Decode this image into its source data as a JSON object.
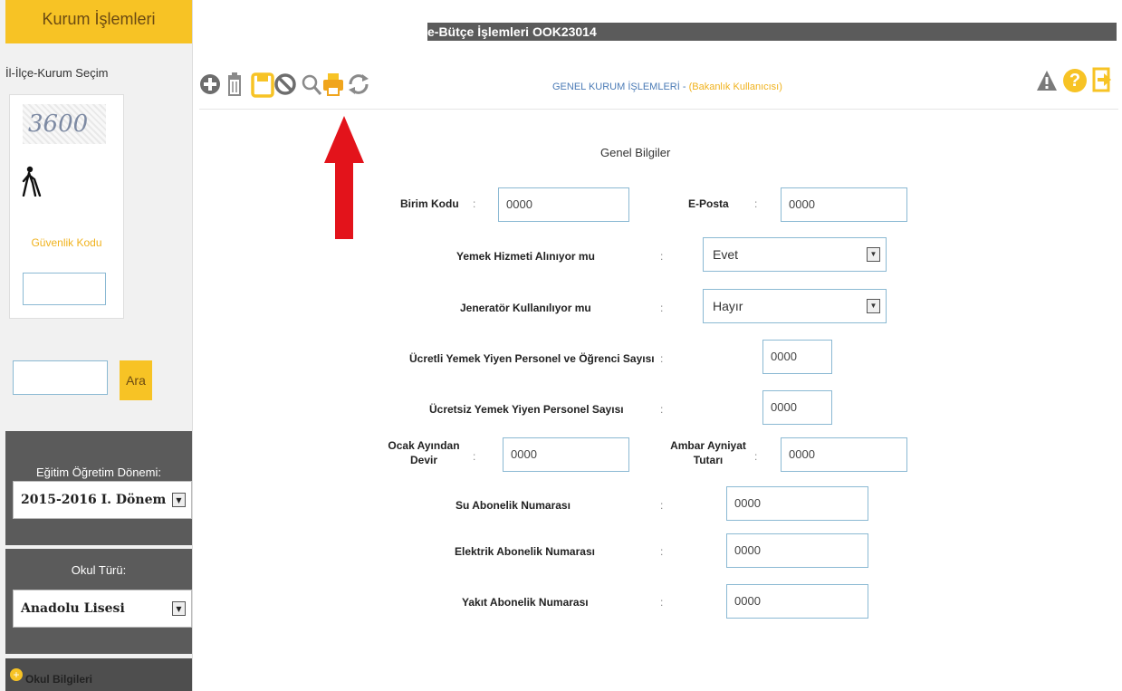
{
  "sidebar": {
    "header": "Kurum İşlemleri",
    "section_label": "İl-İlçe-Kurum Seçim",
    "captcha_text": "3600",
    "security_label": "Güvenlik Kodu",
    "security_value": "",
    "search_value": "",
    "search_button": "Ara",
    "term_label": "Eğitim Öğretim Dönemi:",
    "term_value": "2015-2016 I. Dönem",
    "school_type_label": "Okul Türü:",
    "school_type_value": "Anadolu Lisesi",
    "school_info": "Okul Bilgileri"
  },
  "topbar": {
    "title": "e-Bütçe İşlemleri OOK23014"
  },
  "toolbar": {
    "heading": "GENEL KURUM İŞLEMLERİ -",
    "heading_user": "(Bakanlık Kullanıcısı)",
    "icons": [
      "add-icon",
      "delete-icon",
      "save-icon",
      "cancel-icon",
      "search-icon",
      "print-icon",
      "refresh-icon",
      "warning-icon",
      "help-icon",
      "exit-icon"
    ],
    "help_glyph": "?"
  },
  "form": {
    "title": "Genel Bilgiler",
    "colon": ":",
    "birim_kodu_label": "Birim Kodu",
    "birim_kodu_value": "0000",
    "eposta_label": "E-Posta",
    "eposta_value": "0000",
    "yemek_label": "Yemek Hizmeti Alınıyor mu",
    "yemek_value": "Evet",
    "jenerator_label": "Jeneratör Kullanılıyor mu",
    "jenerator_value": "Hayır",
    "ucretli_label": "Ücretli Yemek Yiyen Personel ve Öğrenci Sayısı",
    "ucretli_value": "0000",
    "ucretsiz_label": "Ücretsiz Yemek Yiyen Personel Sayısı",
    "ucretsiz_value": "0000",
    "ocak_label": "Ocak Ayından Devir",
    "ocak_value": "0000",
    "ambar_label": "Ambar Ayniyat Tutarı",
    "ambar_value": "0000",
    "su_label": "Su Abonelik Numarası",
    "su_value": "0000",
    "elektrik_label": "Elektrik Abonelik Numarası",
    "elektrik_value": "0000",
    "yakit_label": "Yakıt Abonelik Numarası",
    "yakit_value": "0000"
  },
  "colors": {
    "accent": "#f7c325",
    "sidebar_dark": "#5b5b5b",
    "input_border": "#8bb9d3",
    "link_blue": "#4b7bb6",
    "annotation_red": "#e3131b"
  }
}
